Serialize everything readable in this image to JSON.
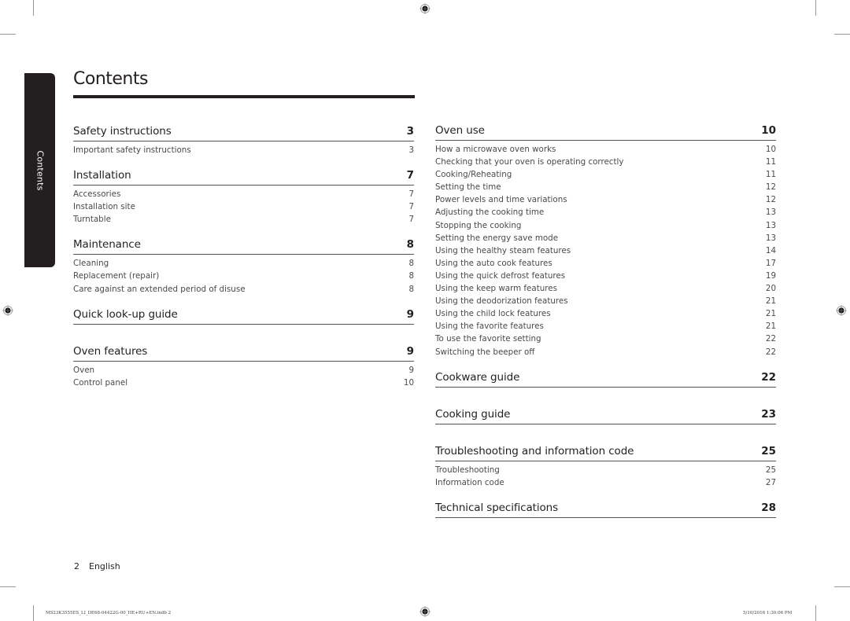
{
  "page_title": "Contents",
  "side_tab": "Contents",
  "left_column": [
    {
      "title": "Safety instructions",
      "page": "3",
      "items": [
        {
          "label": "Important safety instructions",
          "page": "3"
        }
      ]
    },
    {
      "title": "Installation",
      "page": "7",
      "items": [
        {
          "label": "Accessories",
          "page": "7"
        },
        {
          "label": "Installation site",
          "page": "7"
        },
        {
          "label": "Turntable",
          "page": "7"
        }
      ]
    },
    {
      "title": "Maintenance",
      "page": "8",
      "items": [
        {
          "label": "Cleaning",
          "page": "8"
        },
        {
          "label": "Replacement (repair)",
          "page": "8"
        },
        {
          "label": "Care against an extended period of disuse",
          "page": "8"
        }
      ]
    },
    {
      "title": "Quick look-up guide",
      "page": "9",
      "items": []
    },
    {
      "title": "Oven features",
      "page": "9",
      "items": [
        {
          "label": "Oven",
          "page": "9"
        },
        {
          "label": "Control panel",
          "page": "10"
        }
      ]
    }
  ],
  "right_column": [
    {
      "title": "Oven use",
      "page": "10",
      "items": [
        {
          "label": "How a microwave oven works",
          "page": "10"
        },
        {
          "label": "Checking that your oven is operating correctly",
          "page": "11"
        },
        {
          "label": "Cooking/Reheating",
          "page": "11"
        },
        {
          "label": "Setting the time",
          "page": "12"
        },
        {
          "label": "Power levels and time variations",
          "page": "12"
        },
        {
          "label": "Adjusting the cooking time",
          "page": "13"
        },
        {
          "label": "Stopping the cooking",
          "page": "13"
        },
        {
          "label": "Setting the energy save mode",
          "page": "13"
        },
        {
          "label": "Using the healthy steam features",
          "page": "14"
        },
        {
          "label": "Using the auto cook features",
          "page": "17"
        },
        {
          "label": "Using the quick defrost features",
          "page": "19"
        },
        {
          "label": "Using the keep warm features",
          "page": "20"
        },
        {
          "label": "Using the deodorization features",
          "page": "21"
        },
        {
          "label": "Using the child lock features",
          "page": "21"
        },
        {
          "label": "Using the favorite features",
          "page": "21"
        },
        {
          "label": "To use the favorite setting",
          "page": "22"
        },
        {
          "label": "Switching the beeper off",
          "page": "22"
        }
      ]
    },
    {
      "title": "Cookware guide",
      "page": "22",
      "items": []
    },
    {
      "title": "Cooking guide",
      "page": "23",
      "items": []
    },
    {
      "title": "Troubleshooting and information code",
      "page": "25",
      "items": [
        {
          "label": "Troubleshooting",
          "page": "25"
        },
        {
          "label": "Information code",
          "page": "27"
        }
      ]
    },
    {
      "title": "Technical specifications",
      "page": "28",
      "items": []
    }
  ],
  "footer": {
    "page_number": "2",
    "language": "English",
    "slug_file": "MS23K3555ES_LI_DE68-04422G-00_HE+RU+EN.indb   2",
    "slug_date": "5/10/2016   1:30:06 PM"
  }
}
